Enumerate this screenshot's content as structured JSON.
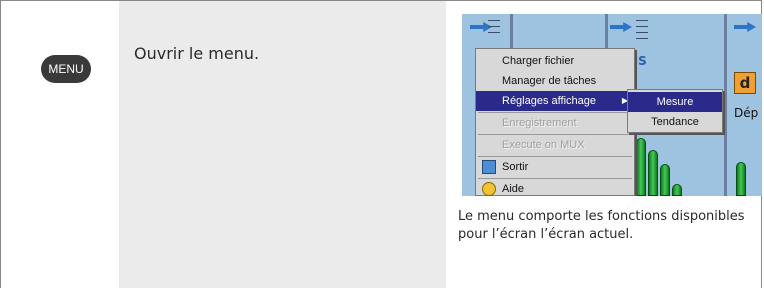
{
  "key": {
    "label": "MENU"
  },
  "instruction": "Ouvrir le menu.",
  "caption": "Le menu comporte les fonctions disponibles pour l’écran l’écran actuel.",
  "screen": {
    "rms_label": "RMS",
    "d_label": "d",
    "dep_label": "Dép",
    "menu_items": [
      {
        "label": "Charger fichier",
        "state": "normal"
      },
      {
        "label": "Manager de tâches",
        "state": "normal"
      },
      {
        "label": "Réglages affichage",
        "state": "selected"
      },
      {
        "label": "Enregistrement",
        "state": "disabled"
      },
      {
        "label": "Execute on MUX",
        "state": "disabled"
      },
      {
        "label": "Sortir",
        "state": "normal",
        "icon": "exit-icon"
      },
      {
        "label": "Aide",
        "state": "normal",
        "icon": "help-icon"
      }
    ],
    "submenu_items": [
      {
        "label": "Mesure",
        "state": "selected"
      },
      {
        "label": "Tendance",
        "state": "normal"
      }
    ],
    "submenu_arrow": "▶"
  }
}
